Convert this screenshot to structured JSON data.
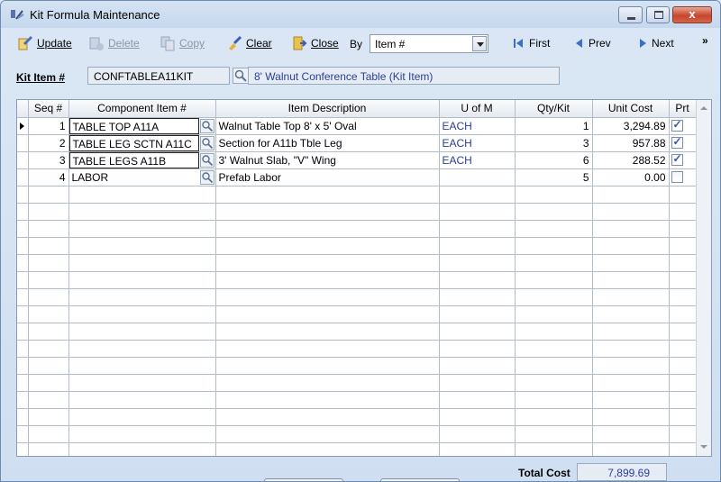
{
  "window": {
    "title": "Kit Formula Maintenance",
    "close_glyph": "x"
  },
  "toolbar": {
    "update_label": "Update",
    "delete_label": "Delete",
    "copy_label": "Copy",
    "clear_label": "Clear",
    "close_label": "Close",
    "by_label": "By",
    "by_value": "Item #",
    "first_label": "First",
    "prev_label": "Prev",
    "next_label": "Next",
    "overflow_glyph": "»"
  },
  "kit": {
    "label": "Kit Item #",
    "value": "CONFTABLEA11KIT",
    "description": "8' Walnut Conference Table (Kit Item)"
  },
  "grid": {
    "columns": [
      "Seq #",
      "Component Item #",
      "Item Description",
      "U of M",
      "Qty/Kit",
      "Unit Cost",
      "Prt"
    ],
    "rows": [
      {
        "seq": "1",
        "item": "TABLE TOP A11A",
        "desc": "Walnut Table Top 8' x 5' Oval",
        "uom": "EACH",
        "qty": "1",
        "cost": "3,294.89",
        "prt": true
      },
      {
        "seq": "2",
        "item": "TABLE LEG SCTN A11C",
        "desc": "Section for A11b Tble Leg",
        "uom": "EACH",
        "qty": "3",
        "cost": "957.88",
        "prt": true
      },
      {
        "seq": "3",
        "item": "TABLE LEGS A11B",
        "desc": "3' Walnut Slab, \"V\"  Wing",
        "uom": "EACH",
        "qty": "6",
        "cost": "288.52",
        "prt": true
      },
      {
        "seq": "4",
        "item": "LABOR",
        "desc": "Prefab Labor",
        "uom": "",
        "qty": "5",
        "cost": "0.00",
        "prt": false
      }
    ]
  },
  "footer": {
    "total_label": "Total Cost",
    "total_value": "7,899.69"
  },
  "colors": {
    "accent_blue": "#2a3e9c",
    "close_red": "#c5462c"
  }
}
